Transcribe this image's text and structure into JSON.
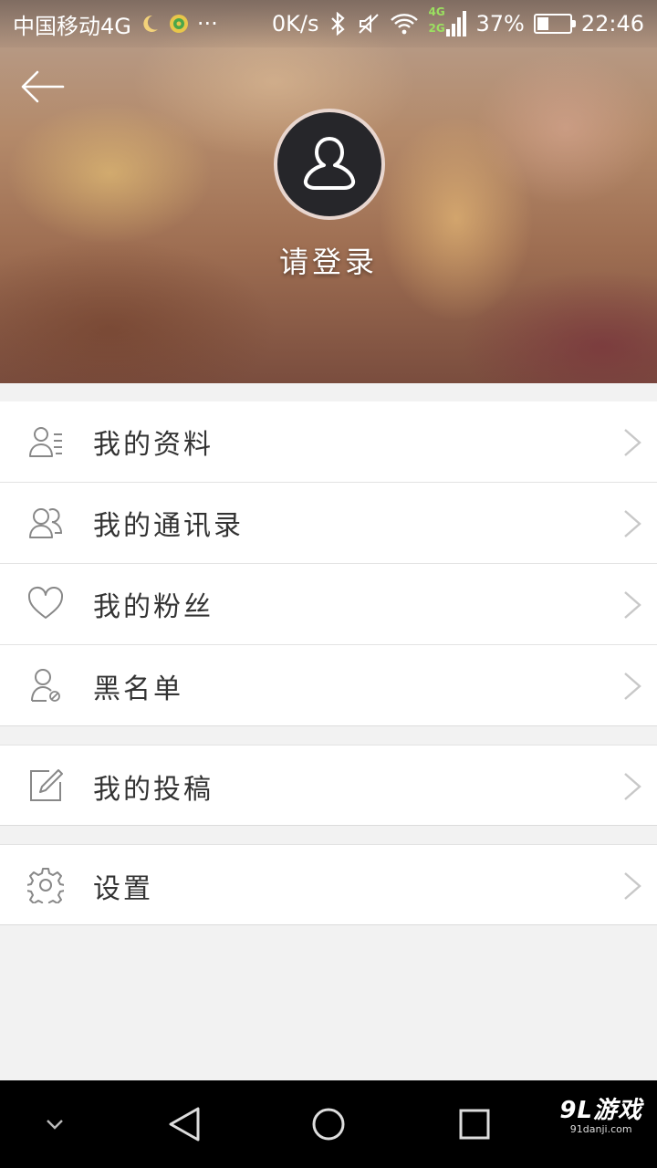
{
  "status_bar": {
    "carrier": "中国移动4G",
    "more": "···",
    "speed": "0K/s",
    "net_top": "4G",
    "net_bottom": "2G",
    "battery": "37%",
    "battery_level": 0.37,
    "time": "22:46"
  },
  "header": {
    "login_prompt": "请登录"
  },
  "menu": {
    "group1": [
      {
        "label": "我的资料",
        "icon": "profile-card-icon"
      },
      {
        "label": "我的通讯录",
        "icon": "contacts-icon"
      },
      {
        "label": "我的粉丝",
        "icon": "heart-icon"
      },
      {
        "label": "黑名单",
        "icon": "blocked-user-icon"
      }
    ],
    "group2": [
      {
        "label": "我的投稿",
        "icon": "edit-icon"
      }
    ],
    "group3": [
      {
        "label": "设置",
        "icon": "gear-icon"
      }
    ]
  },
  "watermark": {
    "main": "9L游戏",
    "sub": "91danji.com"
  },
  "colors": {
    "icon_gray": "#888888",
    "chevron_gray": "#c8c8c8",
    "text": "#333333",
    "background": "#f2f2f2"
  }
}
